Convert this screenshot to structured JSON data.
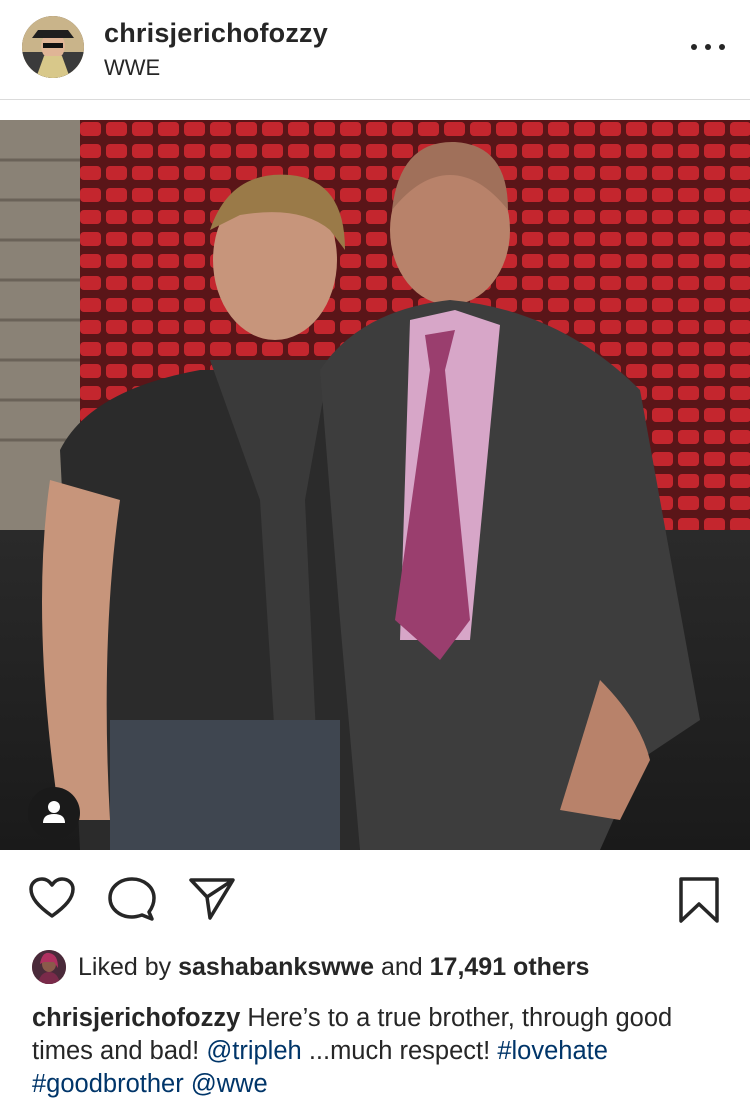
{
  "post": {
    "username": "chrisjerichofozzy",
    "location": "WWE"
  },
  "likes": {
    "prefix": "Liked by",
    "liker": "sashabankswwe",
    "connector": "and",
    "count_text": "17,491 others"
  },
  "caption": {
    "username": "chrisjerichofozzy",
    "text_1": "Here’s to a true brother, through good times and bad!",
    "mention_1": "@tripleh",
    "text_2": "...much respect!",
    "hashtag_1": "#lovehate",
    "hashtag_2": "#goodbrother",
    "mention_2": "@wwe"
  },
  "icons": {
    "more": "more-options-icon",
    "tagged": "user-tag-icon",
    "like": "heart-icon",
    "comment": "comment-icon",
    "share": "share-icon",
    "save": "bookmark-icon"
  },
  "colors": {
    "text": "#262626",
    "link": "#003569",
    "divider": "#dbdbdb",
    "seats": "#c4262e"
  }
}
